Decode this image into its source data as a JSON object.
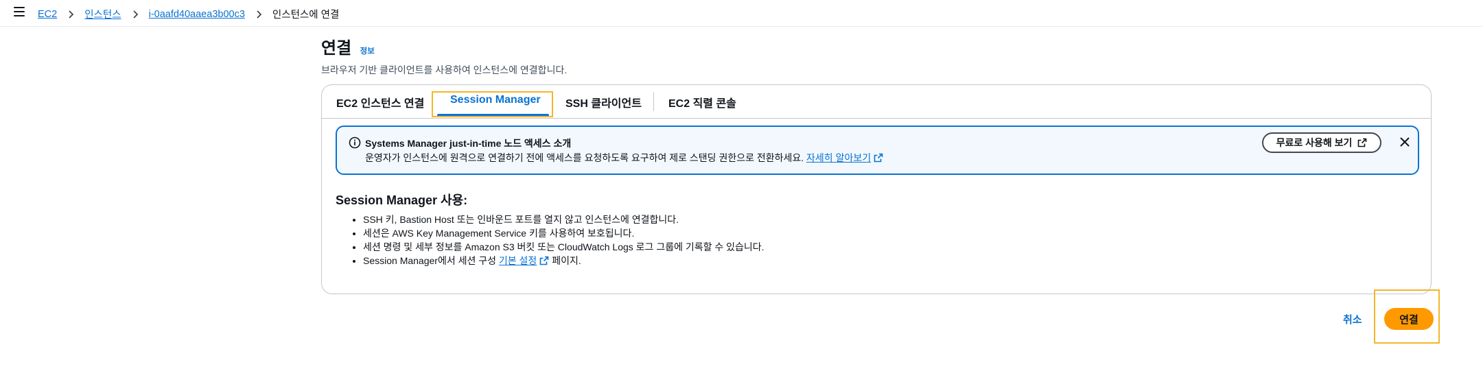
{
  "breadcrumb": {
    "items": [
      "EC2",
      "인스턴스",
      "i-0aafd40aaea3b00c3"
    ],
    "current": "인스턴스에 연결"
  },
  "header": {
    "title": "연결",
    "info": "정보",
    "description": "브라우저 기반 클라이언트를 사용하여 인스턴스에 연결합니다."
  },
  "tabs": [
    {
      "label": "EC2 인스턴스 연결"
    },
    {
      "label": "Session Manager"
    },
    {
      "label": "SSH 클라이언트"
    },
    {
      "label": "EC2 직렬 콘솔"
    }
  ],
  "active_tab": "Session Manager",
  "alert": {
    "title": "Systems Manager just-in-time 노드 액세스 소개",
    "body": "운영자가 인스턴스에 원격으로 연결하기 전에 액세스를 요청하도록 요구하여 제로 스탠딩 권한으로 전환하세요.",
    "link": "자세히 알아보기",
    "button": "무료로 사용해 보기"
  },
  "session": {
    "title": "Session Manager 사용:",
    "bullets": [
      "SSH 키, Bastion Host 또는 인바운드 포트를 열지 않고 인스턴스에 연결합니다.",
      "세션은 AWS Key Management Service 키를 사용하여 보호됩니다.",
      "세션 명령 및 세부 정보를 Amazon S3 버킷 또는 CloudWatch Logs 로그 그룹에 기록할 수 있습니다."
    ],
    "last_bullet_prefix": "Session Manager에서 세션 구성",
    "last_bullet_link": "기본 설정",
    "last_bullet_suffix": "페이지."
  },
  "actions": {
    "cancel": "취소",
    "connect": "연결"
  },
  "colors": {
    "link": "#0972d3",
    "primary_button": "#ff9900",
    "highlight": "#f5b52a",
    "alert_bg": "#f2f8fd"
  }
}
